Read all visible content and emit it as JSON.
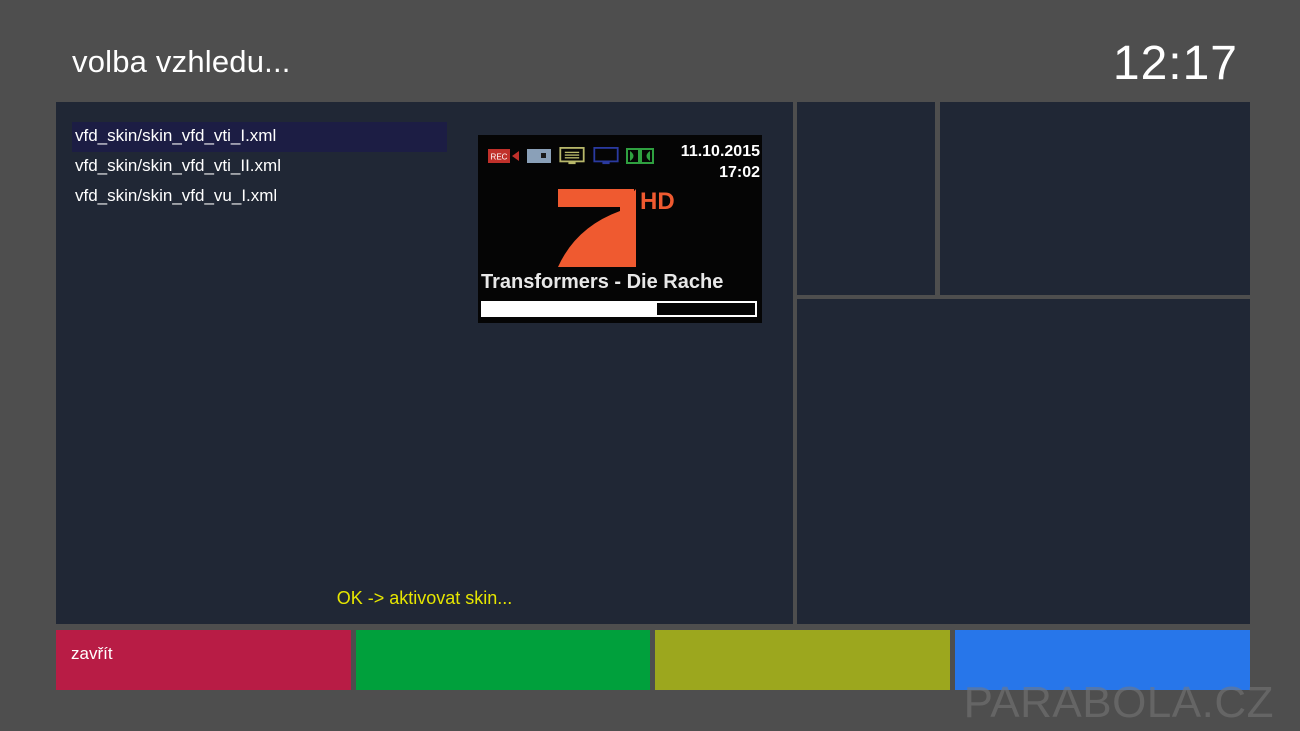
{
  "header": {
    "title": "volba vzhledu...",
    "clock": "12:17"
  },
  "skin_list": {
    "selected_index": 0,
    "items": [
      "vfd_skin/skin_vfd_vti_I.xml",
      "vfd_skin/skin_vfd_vti_II.xml",
      "vfd_skin/skin_vfd_vu_I.xml"
    ]
  },
  "preview": {
    "icons": [
      "rec-icon",
      "camera-icon",
      "teletext-icon",
      "hd-display-icon",
      "dolby-icon"
    ],
    "rec_label": "REC",
    "date": "11.10.2015",
    "time": "17:02",
    "channel_logo": "7",
    "channel_logo_suffix": "HD",
    "program": "Transformers - Die Rache",
    "progress": 0.64,
    "colors": {
      "logo": "#ef5a30",
      "rec": "#c0302a",
      "teletext": "#b8b86a",
      "hd": "#2a3aa0",
      "dolby": "#2fa040"
    }
  },
  "hint": "OK -> aktivovat skin...",
  "buttons": {
    "red": "zavřít",
    "green": "",
    "yellow": "",
    "blue": ""
  },
  "watermark": "PARABOLA.CZ",
  "colors": {
    "background": "#4e4e4e",
    "panel": "#202735",
    "selection": "#1c1d44",
    "hint": "#e6e600",
    "red": "#b81c45",
    "green": "#00a03c",
    "yellow": "#9ca71e",
    "blue": "#2776ea"
  }
}
